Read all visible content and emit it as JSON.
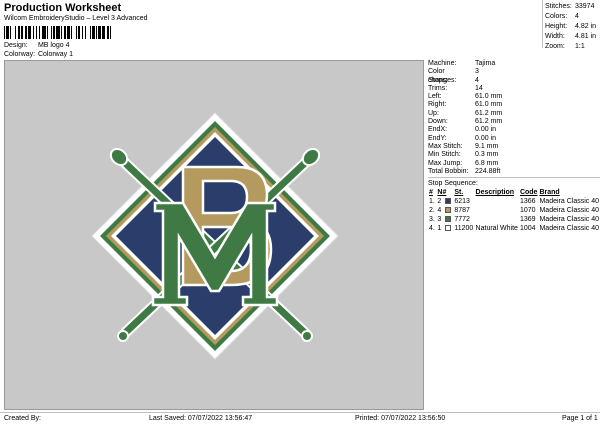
{
  "header": {
    "title": "Production Worksheet",
    "subtitle": "Wilcom EmbroideryStudio – Level 3 Advanced",
    "design_label": "Design:",
    "design_value": "MB logo 4",
    "colorway_label": "Colorway:",
    "colorway_value": "Colorway 1"
  },
  "summary": [
    {
      "k": "Stitches:",
      "v": "33974"
    },
    {
      "k": "Colors:",
      "v": "4"
    },
    {
      "k": "Height:",
      "v": "4.82 in"
    },
    {
      "k": "Width:",
      "v": "4.81 in"
    },
    {
      "k": "Zoom:",
      "v": "1:1"
    }
  ],
  "details": [
    {
      "k": "Machine:",
      "v": "Tajima"
    },
    {
      "k": "Color changes:",
      "v": "3"
    },
    {
      "k": "Stops:",
      "v": "4"
    },
    {
      "k": "Trims:",
      "v": "14"
    },
    {
      "k": "Left:",
      "v": "61.0 mm"
    },
    {
      "k": "Right:",
      "v": "61.0 mm"
    },
    {
      "k": "Up:",
      "v": "61.2 mm"
    },
    {
      "k": "Down:",
      "v": "61.2 mm"
    },
    {
      "k": "EndX:",
      "v": "0.00 in"
    },
    {
      "k": "EndY:",
      "v": "0.00 in"
    },
    {
      "k": "Max Stitch:",
      "v": "9.1 mm"
    },
    {
      "k": "Min Stitch:",
      "v": "0.3 mm"
    },
    {
      "k": "Max Jump:",
      "v": "6.8 mm"
    },
    {
      "k": "Total Bobbin:",
      "v": "224.88ft"
    }
  ],
  "stop_sequence": {
    "title": "Stop Sequence:",
    "headers": [
      "#",
      "N#",
      "St.",
      "Description",
      "Code",
      "Brand"
    ],
    "rows": [
      {
        "num": "1.",
        "n": "2",
        "color": "#2a3d6b",
        "st": "6213",
        "desc": "",
        "code": "1366",
        "brand": "Madeira Classic 40"
      },
      {
        "num": "2.",
        "n": "4",
        "color": "#b59a5f",
        "st": "8787",
        "desc": "",
        "code": "1070",
        "brand": "Madeira Classic 40"
      },
      {
        "num": "3.",
        "n": "3",
        "color": "#3f7a45",
        "st": "7772",
        "desc": "",
        "code": "1369",
        "brand": "Madeira Classic 40"
      },
      {
        "num": "4.",
        "n": "1",
        "color": "#ffffff",
        "st": "11200",
        "desc": "Natural White",
        "code": "1004",
        "brand": "Madeira Classic 40"
      }
    ]
  },
  "footer": {
    "created_by": "Created By:",
    "last_saved": "Last Saved: 07/07/2022 13:56:47",
    "printed": "Printed: 07/07/2022 13:56:50",
    "page": "Page 1 of 1"
  },
  "colors": {
    "navy": "#2a3d6b",
    "gold": "#b59a5f",
    "green": "#3f7a45",
    "white": "#ffffff",
    "background": "#c8c8c8"
  }
}
